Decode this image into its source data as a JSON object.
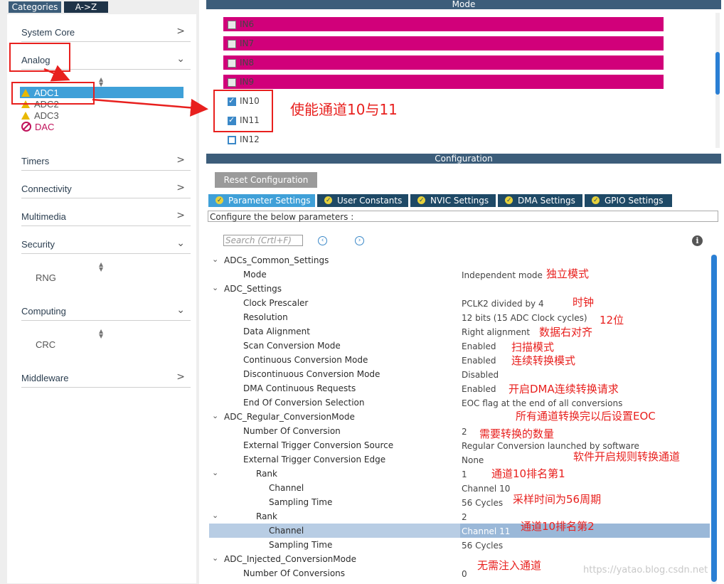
{
  "left_panel": {
    "tabs": [
      "Categories",
      "A->Z"
    ],
    "categories": {
      "system_core": "System Core",
      "analog": "Analog",
      "timers": "Timers",
      "connectivity": "Connectivity",
      "multimedia": "Multimedia",
      "security": "Security",
      "computing": "Computing",
      "middleware": "Middleware"
    },
    "analog_items": [
      "ADC1",
      "ADC2",
      "ADC3",
      "DAC"
    ],
    "security_items": [
      "RNG"
    ],
    "computing_items": [
      "CRC"
    ]
  },
  "mode": {
    "header": "Mode",
    "pins": [
      {
        "label": "IN6",
        "state": "unchecked",
        "highlighted": true
      },
      {
        "label": "IN7",
        "state": "unchecked",
        "highlighted": true
      },
      {
        "label": "IN8",
        "state": "unchecked",
        "highlighted": true
      },
      {
        "label": "IN9",
        "state": "unchecked",
        "highlighted": true
      },
      {
        "label": "IN10",
        "state": "checked",
        "highlighted": false
      },
      {
        "label": "IN11",
        "state": "checked",
        "highlighted": false
      },
      {
        "label": "IN12",
        "state": "unchecked",
        "highlighted": false
      }
    ]
  },
  "configuration": {
    "header": "Configuration",
    "reset_button": "Reset Configuration",
    "tabs": [
      "Parameter Settings",
      "User Constants",
      "NVIC Settings",
      "DMA Settings",
      "GPIO Settings"
    ],
    "configure_text": "Configure the below parameters :",
    "search_placeholder": "Search (Crtl+F)",
    "params": [
      {
        "key": "ADCs_Common_Settings",
        "value": ""
      },
      {
        "key": "Mode",
        "value": "Independent mode"
      },
      {
        "key": "ADC_Settings",
        "value": ""
      },
      {
        "key": "Clock Prescaler",
        "value": "PCLK2 divided by 4"
      },
      {
        "key": "Resolution",
        "value": "12 bits (15 ADC Clock cycles)"
      },
      {
        "key": "Data Alignment",
        "value": "Right alignment"
      },
      {
        "key": "Scan Conversion Mode",
        "value": "Enabled"
      },
      {
        "key": "Continuous Conversion Mode",
        "value": "Enabled"
      },
      {
        "key": "Discontinuous Conversion Mode",
        "value": "Disabled"
      },
      {
        "key": "DMA Continuous Requests",
        "value": "Enabled"
      },
      {
        "key": "End Of Conversion Selection",
        "value": "EOC flag at the end of all conversions"
      },
      {
        "key": "ADC_Regular_ConversionMode",
        "value": ""
      },
      {
        "key": "Number Of Conversion",
        "value": "2"
      },
      {
        "key": "External Trigger Conversion Source",
        "value": "Regular Conversion launched by software"
      },
      {
        "key": "External Trigger Conversion Edge",
        "value": "None"
      },
      {
        "key": "Rank",
        "value": "1"
      },
      {
        "key": "Channel",
        "value": "Channel 10"
      },
      {
        "key": "Sampling Time",
        "value": "56 Cycles"
      },
      {
        "key": "Rank",
        "value": "2"
      },
      {
        "key": "Channel",
        "value": "Channel 11"
      },
      {
        "key": "Sampling Time",
        "value": "56 Cycles"
      },
      {
        "key": "ADC_Injected_ConversionMode",
        "value": ""
      },
      {
        "key": "Number Of Conversions",
        "value": "0"
      }
    ]
  },
  "annotations": {
    "enable_channels": "使能通道10与11",
    "independent": "独立模式",
    "clock": "时钟",
    "bits": "12位",
    "right_align": "数据右对齐",
    "scan": "扫描模式",
    "continuous": "连续转换模式",
    "dma": "开启DMA连续转换请求",
    "eoc": "所有通道转换完以后设置EOC",
    "num_conv": "需要转换的数量",
    "software": "软件开启规则转换通道",
    "rank1": "通道10排名第1",
    "sample": "采样时间为56周期",
    "rank2": "通道10排名第2",
    "no_inject": "无需注入通道"
  },
  "watermark": "https://yatao.blog.csdn.net",
  "colors": {
    "header_bg": "#3c5d7a",
    "pin_highlight": "#d1007a",
    "active_tab": "#3fa0d8",
    "annotation_red": "#e8201e"
  }
}
